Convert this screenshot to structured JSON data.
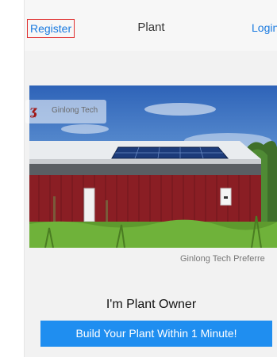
{
  "nav": {
    "register_label": "Register",
    "title": "Plant",
    "login_label": "Login"
  },
  "hero": {
    "brand_text": "Ginlong Tech",
    "caption": "Ginlong Tech Preferre"
  },
  "main": {
    "owner_label": "I'm Plant Owner",
    "cta_label": "Build Your Plant Within 1 Minute!"
  },
  "colors": {
    "accent": "#1f8ef0",
    "link": "#1a7ae0",
    "highlight_border": "#e03030"
  }
}
